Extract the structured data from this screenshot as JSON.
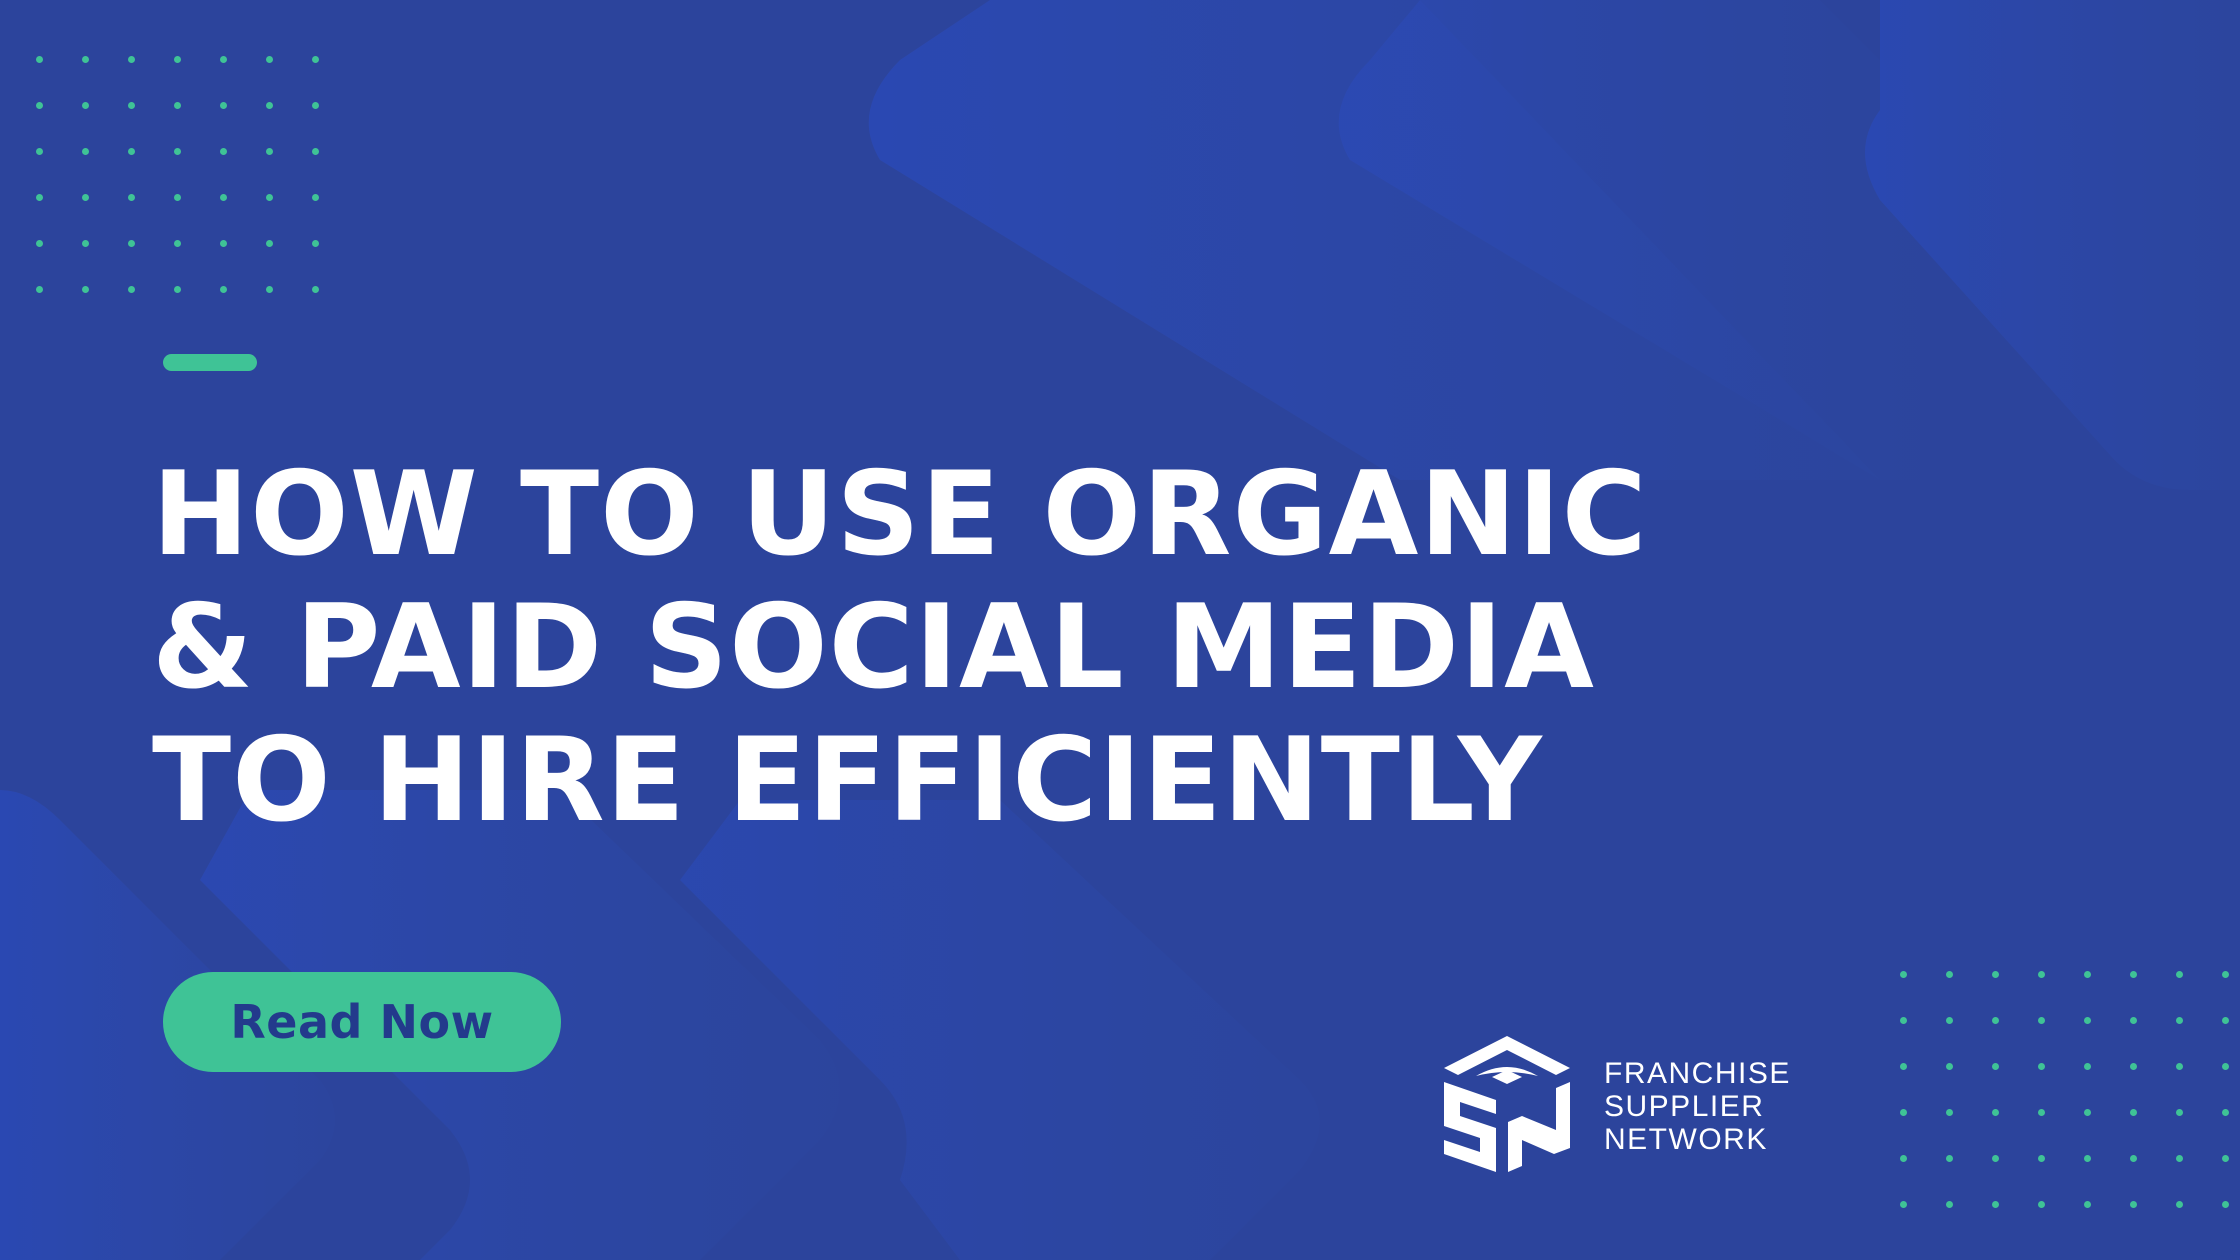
{
  "colors": {
    "background": "#2c449c",
    "accent": "#3fc396",
    "text": "#ffffff",
    "button_text": "#233a8c"
  },
  "headline": {
    "lines": [
      "HOW TO USE ORGANIC",
      "& PAID SOCIAL MEDIA",
      "TO HIRE EFFICIENTLY"
    ]
  },
  "cta": {
    "label": "Read Now"
  },
  "brand": {
    "logo_icon": "fsn-cube-logo-icon",
    "logo_mark_text": "FSN",
    "name_lines": [
      "FRANCHISE",
      "SUPPLIER",
      "NETWORK"
    ]
  },
  "decor": {
    "dot_grid_icon": "dot-grid-pattern",
    "accent_bar_icon": "accent-bar",
    "chevrons_icon": "chevron-background-shapes"
  }
}
